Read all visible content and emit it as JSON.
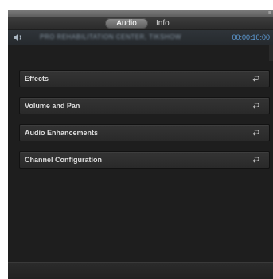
{
  "tabs": [
    {
      "label": "Audio",
      "active": true
    },
    {
      "label": "Info",
      "active": false
    }
  ],
  "clip": {
    "name": "PRO REHABILITATION CENTER, TIKSHOW",
    "timecode": "00:00:10:00"
  },
  "sections": [
    {
      "label": "Effects",
      "icon": "reset-icon"
    },
    {
      "label": "Volume and Pan",
      "icon": "reset-icon"
    },
    {
      "label": "Audio Enhancements",
      "icon": "reset-icon"
    },
    {
      "label": "Channel Configuration",
      "icon": "reset-icon"
    }
  ],
  "colors": {
    "timecode": "#5f9ed9",
    "panel": "#1e1e1e",
    "active_tab": "#8e8e8e"
  }
}
